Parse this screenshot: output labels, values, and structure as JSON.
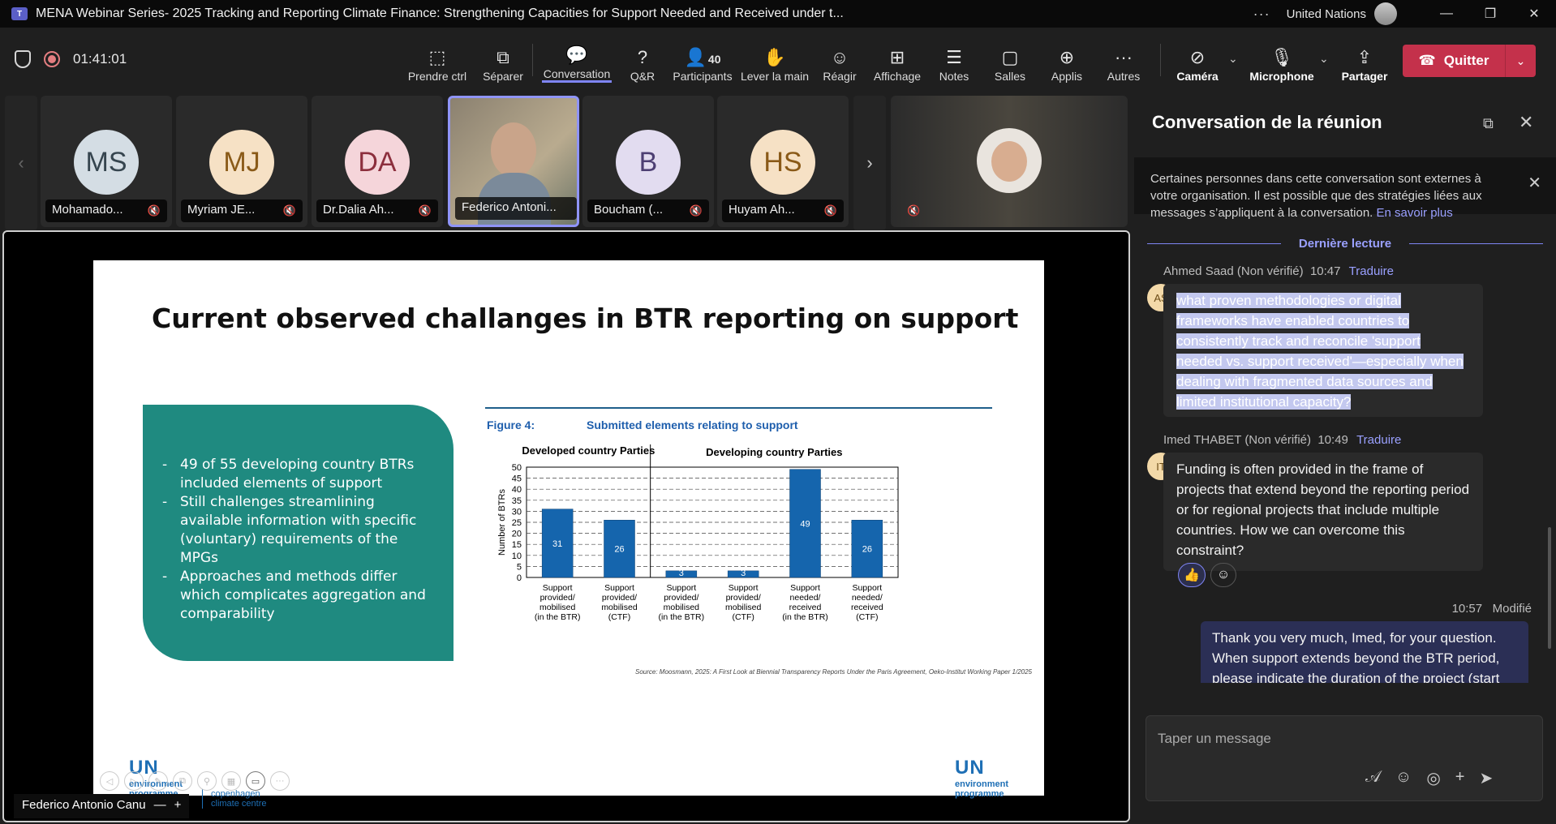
{
  "window": {
    "title": "MENA Webinar Series- 2025 Tracking and Reporting Climate Finance: Strengthening Capacities for Support Needed and Received under t...",
    "organization": "United Nations",
    "minimize": "—",
    "maximize": "❐",
    "close": "✕"
  },
  "meeting": {
    "timer": "01:41:01"
  },
  "toolbar": {
    "take_control": "Prendre ctrl",
    "separate": "Séparer",
    "conversation": "Conversation",
    "qa": "Q&R",
    "participants": "Participants",
    "participants_count": "40",
    "raise_hand": "Lever la main",
    "react": "Réagir",
    "view": "Affichage",
    "notes": "Notes",
    "rooms": "Salles",
    "apps": "Applis",
    "more": "Autres",
    "camera": "Caméra",
    "microphone": "Microphone",
    "share": "Partager",
    "quit": "Quitter"
  },
  "participants": [
    {
      "initials": "MS",
      "name": "Mohamado...",
      "bg": "#d4dde4",
      "fg": "#36454f"
    },
    {
      "initials": "MJ",
      "name": "Myriam JE...",
      "bg": "#f6e1c5",
      "fg": "#8a5a18"
    },
    {
      "initials": "DA",
      "name": "Dr.Dalia Ah...",
      "bg": "#f5d5da",
      "fg": "#8c2f3d"
    },
    {
      "initials": "",
      "name": "Federico Antoni..."
    },
    {
      "initials": "B",
      "name": "Boucham (...",
      "bg": "#e2dcf0",
      "fg": "#4d3f73"
    },
    {
      "initials": "HS",
      "name": "Huyam Ah...",
      "bg": "#f6e1c5",
      "fg": "#8a5a18"
    }
  ],
  "slide": {
    "title": "Current observed challanges in BTR reporting on support",
    "bullets": [
      "49 of 55 developing country BTRs included elements of support",
      "Still challenges streamlining available information with specific (voluntary) requirements of the MPGs",
      "Approaches and methods differ which complicates aggregation and comparability"
    ],
    "figure_label": "Figure 4:",
    "figure_title": "Submitted elements relating to support",
    "source_prefix": "Source: Moosmann, 2025: ",
    "source_italic": "A First Look at Biennial Transparency Reports Under the Paris Agreement, Oeko-Institut Working Paper 1/2025",
    "logo_un": "UN",
    "logo_env": "environment",
    "logo_prog": "programme",
    "logo_cph1": "copenhagen",
    "logo_cph2": "climate centre"
  },
  "chart_data": {
    "type": "bar",
    "groups": [
      "Developed country Parties",
      "Developing country Parties"
    ],
    "categories": [
      "Support provided/ mobilised (in the BTR)",
      "Support provided/ mobilised (CTF)",
      "Support provided/ mobilised (in the BTR)",
      "Support provided/ mobilised (CTF)",
      "Support needed/ received (in the BTR)",
      "Support needed/ received (CTF)"
    ],
    "category_lines": [
      [
        "Support",
        "provided/",
        "mobilised",
        "(in the BTR)"
      ],
      [
        "Support",
        "provided/",
        "mobilised",
        "(CTF)"
      ],
      [
        "Support",
        "provided/",
        "mobilised",
        "(in the BTR)"
      ],
      [
        "Support",
        "provided/",
        "mobilised",
        "(CTF)"
      ],
      [
        "Support",
        "needed/",
        "received",
        "(in the BTR)"
      ],
      [
        "Support",
        "needed/",
        "received",
        "(CTF)"
      ]
    ],
    "values": [
      31,
      26,
      3,
      3,
      49,
      26
    ],
    "ylabel": "Number of BTRs",
    "ylim": [
      0,
      50
    ],
    "yticks": [
      0,
      5,
      10,
      15,
      20,
      25,
      30,
      35,
      40,
      45,
      50
    ],
    "color": "#1565ad",
    "grid": true
  },
  "presenter": {
    "name": "Federico Antonio Canu",
    "minus": "—",
    "plus": "+"
  },
  "chat": {
    "title": "Conversation de la réunion",
    "notice": "Certaines personnes dans cette conversation sont externes à votre organisation. Il est possible que des stratégies liées aux messages s’appliquent à la conversation.",
    "notice_link": "En savoir plus",
    "last_read": "Dernière lecture",
    "messages": [
      {
        "initials": "AS",
        "author": "Ahmed Saad (Non vérifié)",
        "time": "10:47",
        "translate": "Traduire",
        "text": "what proven methodologies or digital frameworks have enabled countries to consistently track and reconcile 'support needed vs. support received'—especially when dealing with fragmented data sources and limited institutional capacity?"
      },
      {
        "initials": "IT",
        "author": "Imed THABET (Non vérifié)",
        "time": "10:49",
        "translate": "Traduire",
        "text": "Funding is often provided in the frame of projects that extend beyond the reporting  period or for regional projects that include multiple countries. How we can overcome this constraint?"
      }
    ],
    "own_time": "10:57",
    "own_modified": "Modifié",
    "own_text": "Thank you very much, Imed, for your question. When support extends beyond the BTR period, please indicate the duration of the project (start",
    "composer_placeholder": "Taper un message"
  }
}
